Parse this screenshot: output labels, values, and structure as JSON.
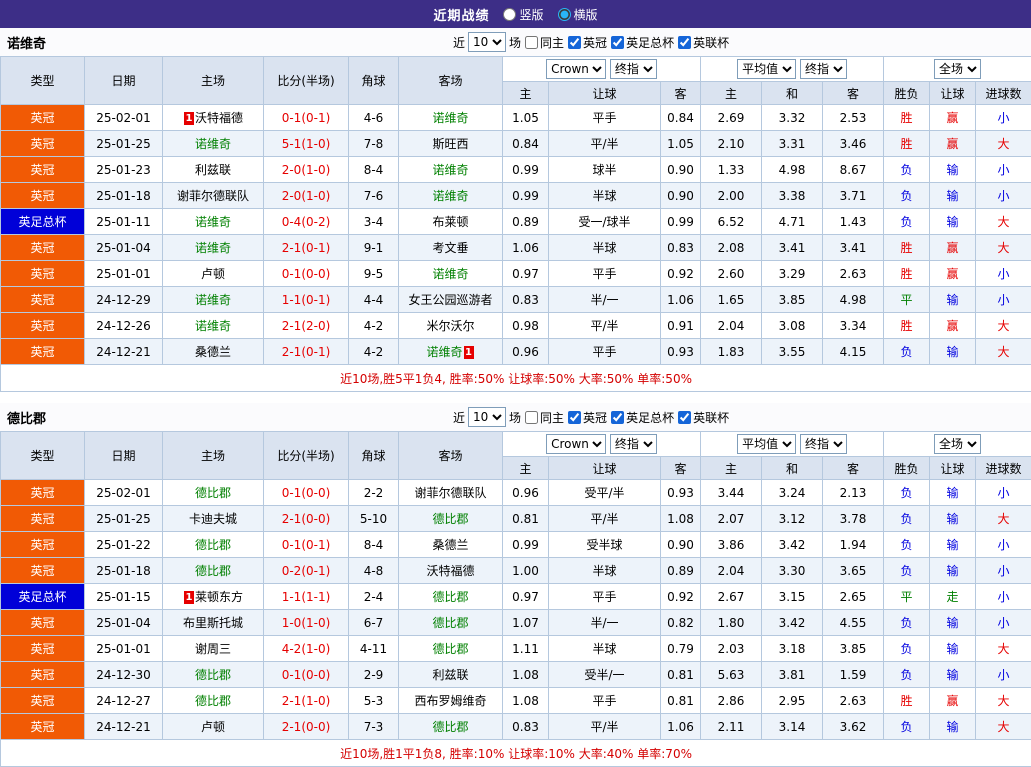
{
  "top_bar": {
    "title": "近期战绩",
    "vertical": "竖版",
    "horizontal": "横版"
  },
  "filters": {
    "near": "近",
    "count": "10",
    "matches": "场",
    "same_home": "同主",
    "leagues": [
      "英冠",
      "英足总杯",
      "英联杯"
    ]
  },
  "columns": {
    "type": "类型",
    "date": "日期",
    "home": "主场",
    "score": "比分(半场)",
    "corner": "角球",
    "away": "客场",
    "crow_select": "Crown",
    "final_select": "终指",
    "avg_select": "平均值",
    "final_select2": "终指",
    "full_select": "全场",
    "sub": [
      "主",
      "让球",
      "客",
      "主",
      "和",
      "客",
      "胜负",
      "让球",
      "进球数"
    ]
  },
  "sections": [
    {
      "team": "诺维奇",
      "footer": "近10场,胜5平1负4, 胜率:50% 让球率:50% 大率:50% 单率:50%",
      "rows": [
        {
          "type": "英冠",
          "cup": false,
          "date": "25-02-01",
          "home": "沃特福德",
          "home_self": false,
          "home_card": true,
          "score": "0-1(0-1)",
          "corner": "4-6",
          "away": "诺维奇",
          "away_self": true,
          "away_card": false,
          "crow": [
            "1.05",
            "平手",
            "0.84"
          ],
          "avg": [
            "2.69",
            "3.32",
            "2.53"
          ],
          "res": [
            "胜",
            "赢",
            "小"
          ]
        },
        {
          "type": "英冠",
          "cup": false,
          "date": "25-01-25",
          "home": "诺维奇",
          "home_self": true,
          "home_card": false,
          "score": "5-1(1-0)",
          "corner": "7-8",
          "away": "斯旺西",
          "away_self": false,
          "away_card": false,
          "crow": [
            "0.84",
            "平/半",
            "1.05"
          ],
          "avg": [
            "2.10",
            "3.31",
            "3.46"
          ],
          "res": [
            "胜",
            "赢",
            "大"
          ]
        },
        {
          "type": "英冠",
          "cup": false,
          "date": "25-01-23",
          "home": "利兹联",
          "home_self": false,
          "home_card": false,
          "score": "2-0(1-0)",
          "corner": "8-4",
          "away": "诺维奇",
          "away_self": true,
          "away_card": false,
          "crow": [
            "0.99",
            "球半",
            "0.90"
          ],
          "avg": [
            "1.33",
            "4.98",
            "8.67"
          ],
          "res": [
            "负",
            "输",
            "小"
          ]
        },
        {
          "type": "英冠",
          "cup": false,
          "date": "25-01-18",
          "home": "谢菲尔德联队",
          "home_self": false,
          "home_card": false,
          "score": "2-0(1-0)",
          "corner": "7-6",
          "away": "诺维奇",
          "away_self": true,
          "away_card": false,
          "crow": [
            "0.99",
            "半球",
            "0.90"
          ],
          "avg": [
            "2.00",
            "3.38",
            "3.71"
          ],
          "res": [
            "负",
            "输",
            "小"
          ]
        },
        {
          "type": "英足总杯",
          "cup": true,
          "date": "25-01-11",
          "home": "诺维奇",
          "home_self": true,
          "home_card": false,
          "score": "0-4(0-2)",
          "corner": "3-4",
          "away": "布莱顿",
          "away_self": false,
          "away_card": false,
          "crow": [
            "0.89",
            "受一/球半",
            "0.99"
          ],
          "avg": [
            "6.52",
            "4.71",
            "1.43"
          ],
          "res": [
            "负",
            "输",
            "大"
          ]
        },
        {
          "type": "英冠",
          "cup": false,
          "date": "25-01-04",
          "home": "诺维奇",
          "home_self": true,
          "home_card": false,
          "score": "2-1(0-1)",
          "corner": "9-1",
          "away": "考文垂",
          "away_self": false,
          "away_card": false,
          "crow": [
            "1.06",
            "半球",
            "0.83"
          ],
          "avg": [
            "2.08",
            "3.41",
            "3.41"
          ],
          "res": [
            "胜",
            "赢",
            "大"
          ]
        },
        {
          "type": "英冠",
          "cup": false,
          "date": "25-01-01",
          "home": "卢顿",
          "home_self": false,
          "home_card": false,
          "score": "0-1(0-0)",
          "corner": "9-5",
          "away": "诺维奇",
          "away_self": true,
          "away_card": false,
          "crow": [
            "0.97",
            "平手",
            "0.92"
          ],
          "avg": [
            "2.60",
            "3.29",
            "2.63"
          ],
          "res": [
            "胜",
            "赢",
            "小"
          ]
        },
        {
          "type": "英冠",
          "cup": false,
          "date": "24-12-29",
          "home": "诺维奇",
          "home_self": true,
          "home_card": false,
          "score": "1-1(0-1)",
          "corner": "4-4",
          "away": "女王公园巡游者",
          "away_self": false,
          "away_card": false,
          "crow": [
            "0.83",
            "半/一",
            "1.06"
          ],
          "avg": [
            "1.65",
            "3.85",
            "4.98"
          ],
          "res": [
            "平",
            "输",
            "小"
          ]
        },
        {
          "type": "英冠",
          "cup": false,
          "date": "24-12-26",
          "home": "诺维奇",
          "home_self": true,
          "home_card": false,
          "score": "2-1(2-0)",
          "corner": "4-2",
          "away": "米尔沃尔",
          "away_self": false,
          "away_card": false,
          "crow": [
            "0.98",
            "平/半",
            "0.91"
          ],
          "avg": [
            "2.04",
            "3.08",
            "3.34"
          ],
          "res": [
            "胜",
            "赢",
            "大"
          ]
        },
        {
          "type": "英冠",
          "cup": false,
          "date": "24-12-21",
          "home": "桑德兰",
          "home_self": false,
          "home_card": false,
          "score": "2-1(0-1)",
          "corner": "4-2",
          "away": "诺维奇",
          "away_self": true,
          "away_card": true,
          "crow": [
            "0.96",
            "平手",
            "0.93"
          ],
          "avg": [
            "1.83",
            "3.55",
            "4.15"
          ],
          "res": [
            "负",
            "输",
            "大"
          ]
        }
      ]
    },
    {
      "team": "德比郡",
      "footer": "近10场,胜1平1负8, 胜率:10% 让球率:10% 大率:40% 单率:70%",
      "rows": [
        {
          "type": "英冠",
          "cup": false,
          "date": "25-02-01",
          "home": "德比郡",
          "home_self": true,
          "home_card": false,
          "score": "0-1(0-0)",
          "corner": "2-2",
          "away": "谢菲尔德联队",
          "away_self": false,
          "away_card": false,
          "crow": [
            "0.96",
            "受平/半",
            "0.93"
          ],
          "avg": [
            "3.44",
            "3.24",
            "2.13"
          ],
          "res": [
            "负",
            "输",
            "小"
          ]
        },
        {
          "type": "英冠",
          "cup": false,
          "date": "25-01-25",
          "home": "卡迪夫城",
          "home_self": false,
          "home_card": false,
          "score": "2-1(0-0)",
          "corner": "5-10",
          "away": "德比郡",
          "away_self": true,
          "away_card": false,
          "crow": [
            "0.81",
            "平/半",
            "1.08"
          ],
          "avg": [
            "2.07",
            "3.12",
            "3.78"
          ],
          "res": [
            "负",
            "输",
            "大"
          ]
        },
        {
          "type": "英冠",
          "cup": false,
          "date": "25-01-22",
          "home": "德比郡",
          "home_self": true,
          "home_card": false,
          "score": "0-1(0-1)",
          "corner": "8-4",
          "away": "桑德兰",
          "away_self": false,
          "away_card": false,
          "crow": [
            "0.99",
            "受半球",
            "0.90"
          ],
          "avg": [
            "3.86",
            "3.42",
            "1.94"
          ],
          "res": [
            "负",
            "输",
            "小"
          ]
        },
        {
          "type": "英冠",
          "cup": false,
          "date": "25-01-18",
          "home": "德比郡",
          "home_self": true,
          "home_card": false,
          "score": "0-2(0-1)",
          "corner": "4-8",
          "away": "沃特福德",
          "away_self": false,
          "away_card": false,
          "crow": [
            "1.00",
            "半球",
            "0.89"
          ],
          "avg": [
            "2.04",
            "3.30",
            "3.65"
          ],
          "res": [
            "负",
            "输",
            "小"
          ]
        },
        {
          "type": "英足总杯",
          "cup": true,
          "date": "25-01-15",
          "home": "莱顿东方",
          "home_self": false,
          "home_card": true,
          "score": "1-1(1-1)",
          "corner": "2-4",
          "away": "德比郡",
          "away_self": true,
          "away_card": false,
          "crow": [
            "0.97",
            "平手",
            "0.92"
          ],
          "avg": [
            "2.67",
            "3.15",
            "2.65"
          ],
          "res": [
            "平",
            "走",
            "小"
          ]
        },
        {
          "type": "英冠",
          "cup": false,
          "date": "25-01-04",
          "home": "布里斯托城",
          "home_self": false,
          "home_card": false,
          "score": "1-0(1-0)",
          "corner": "6-7",
          "away": "德比郡",
          "away_self": true,
          "away_card": false,
          "crow": [
            "1.07",
            "半/一",
            "0.82"
          ],
          "avg": [
            "1.80",
            "3.42",
            "4.55"
          ],
          "res": [
            "负",
            "输",
            "小"
          ]
        },
        {
          "type": "英冠",
          "cup": false,
          "date": "25-01-01",
          "home": "谢周三",
          "home_self": false,
          "home_card": false,
          "score": "4-2(1-0)",
          "corner": "4-11",
          "away": "德比郡",
          "away_self": true,
          "away_card": false,
          "crow": [
            "1.11",
            "半球",
            "0.79"
          ],
          "avg": [
            "2.03",
            "3.18",
            "3.85"
          ],
          "res": [
            "负",
            "输",
            "大"
          ]
        },
        {
          "type": "英冠",
          "cup": false,
          "date": "24-12-30",
          "home": "德比郡",
          "home_self": true,
          "home_card": false,
          "score": "0-1(0-0)",
          "corner": "2-9",
          "away": "利兹联",
          "away_self": false,
          "away_card": false,
          "crow": [
            "1.08",
            "受半/一",
            "0.81"
          ],
          "avg": [
            "5.63",
            "3.81",
            "1.59"
          ],
          "res": [
            "负",
            "输",
            "小"
          ]
        },
        {
          "type": "英冠",
          "cup": false,
          "date": "24-12-27",
          "home": "德比郡",
          "home_self": true,
          "home_card": false,
          "score": "2-1(1-0)",
          "corner": "5-3",
          "away": "西布罗姆维奇",
          "away_self": false,
          "away_card": false,
          "crow": [
            "1.08",
            "平手",
            "0.81"
          ],
          "avg": [
            "2.86",
            "2.95",
            "2.63"
          ],
          "res": [
            "胜",
            "赢",
            "大"
          ]
        },
        {
          "type": "英冠",
          "cup": false,
          "date": "24-12-21",
          "home": "卢顿",
          "home_self": false,
          "home_card": false,
          "score": "2-1(0-0)",
          "corner": "7-3",
          "away": "德比郡",
          "away_self": true,
          "away_card": false,
          "crow": [
            "0.83",
            "平/半",
            "1.06"
          ],
          "avg": [
            "2.11",
            "3.14",
            "3.62"
          ],
          "res": [
            "负",
            "输",
            "大"
          ]
        }
      ]
    }
  ]
}
